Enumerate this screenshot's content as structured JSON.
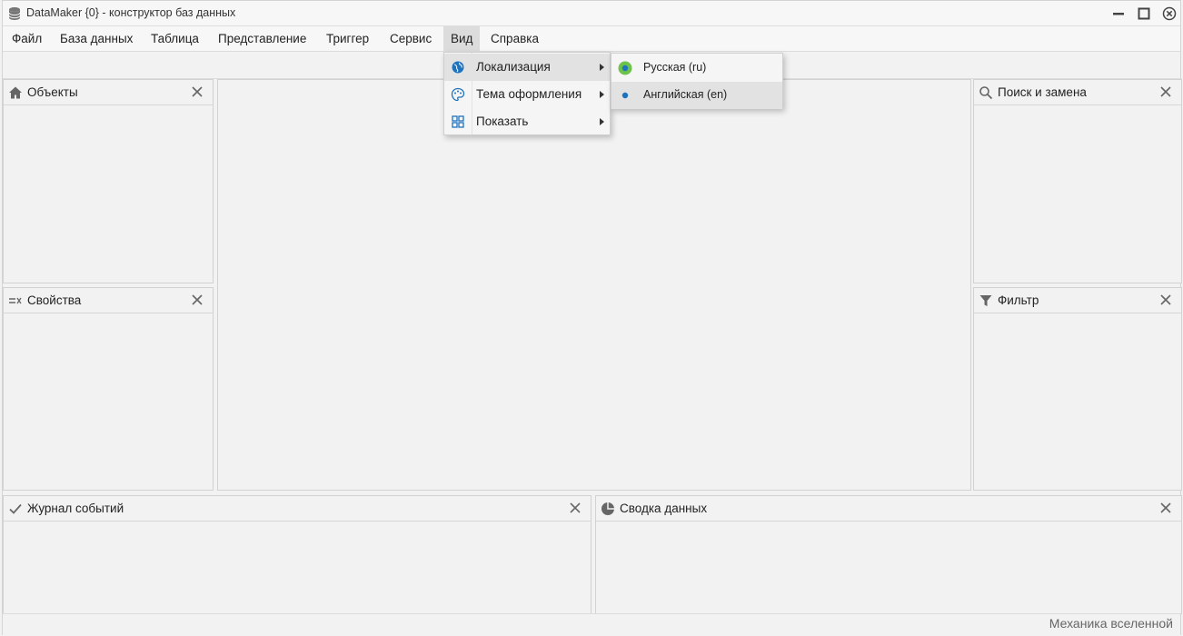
{
  "window": {
    "title": "DataMaker {0} - конструктор баз данных"
  },
  "menu": [
    {
      "label": "Файл"
    },
    {
      "label": "База данных"
    },
    {
      "label": "Таблица"
    },
    {
      "label": "Представление"
    },
    {
      "label": "Триггер"
    },
    {
      "label": "Сервис"
    },
    {
      "label": "Вид"
    },
    {
      "label": "Справка"
    }
  ],
  "panels": {
    "objects": {
      "title": "Объекты"
    },
    "properties": {
      "title": "Свойства"
    },
    "search": {
      "title": "Поиск и замена"
    },
    "filter": {
      "title": "Фильтр"
    },
    "log": {
      "title": "Журнал событий"
    },
    "summary": {
      "title": "Сводка данных"
    }
  },
  "view_menu": {
    "items": [
      {
        "label": "Локализация",
        "icon": "globe-icon"
      },
      {
        "label": "Тема оформления",
        "icon": "palette-icon"
      },
      {
        "label": "Показать",
        "icon": "grid-icon"
      }
    ]
  },
  "localization_menu": {
    "items": [
      {
        "label": "Русская (ru)",
        "selected": true
      },
      {
        "label": "Английская (en)",
        "selected": false
      }
    ]
  },
  "status": {
    "text": "Механика вселенной"
  },
  "colors": {
    "accent": "#1e73be",
    "radio_selected": "#6cc24a"
  }
}
